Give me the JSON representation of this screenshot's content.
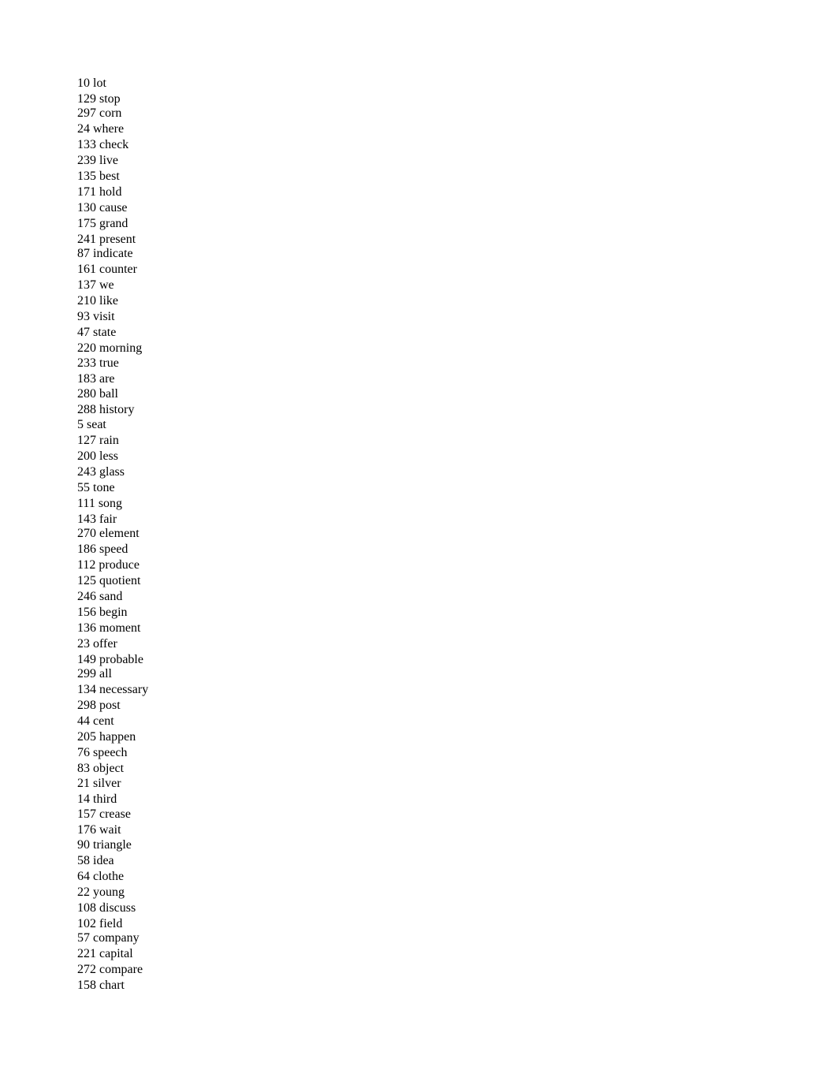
{
  "document": {
    "lines": [
      "10 lot",
      "129 stop",
      "297 corn",
      "24 where",
      "133 check",
      "239 live",
      "135 best",
      "171 hold",
      "130 cause",
      "175 grand",
      "241 present",
      "87 indicate",
      "161 counter",
      "137 we",
      "210 like",
      "93 visit",
      "47 state",
      "220 morning",
      "233 true",
      "183 are",
      "280 ball",
      "288 history",
      "5 seat",
      "127 rain",
      "200 less",
      "243 glass",
      "55 tone",
      "111 song",
      "143 fair",
      "270 element",
      "186 speed",
      "112 produce",
      "125 quotient",
      "246 sand",
      "156 begin",
      "136 moment",
      "23 offer",
      "149 probable",
      "299 all",
      "134 necessary",
      "298 post",
      "44 cent",
      "205 happen",
      "76 speech",
      "83 object",
      "21 silver",
      "14 third",
      "157 crease",
      "176 wait",
      "90 triangle",
      "58 idea",
      "64 clothe",
      "22 young",
      "108 discuss",
      "102 field",
      "57 company",
      "221 capital",
      "272 compare",
      "158 chart"
    ]
  }
}
